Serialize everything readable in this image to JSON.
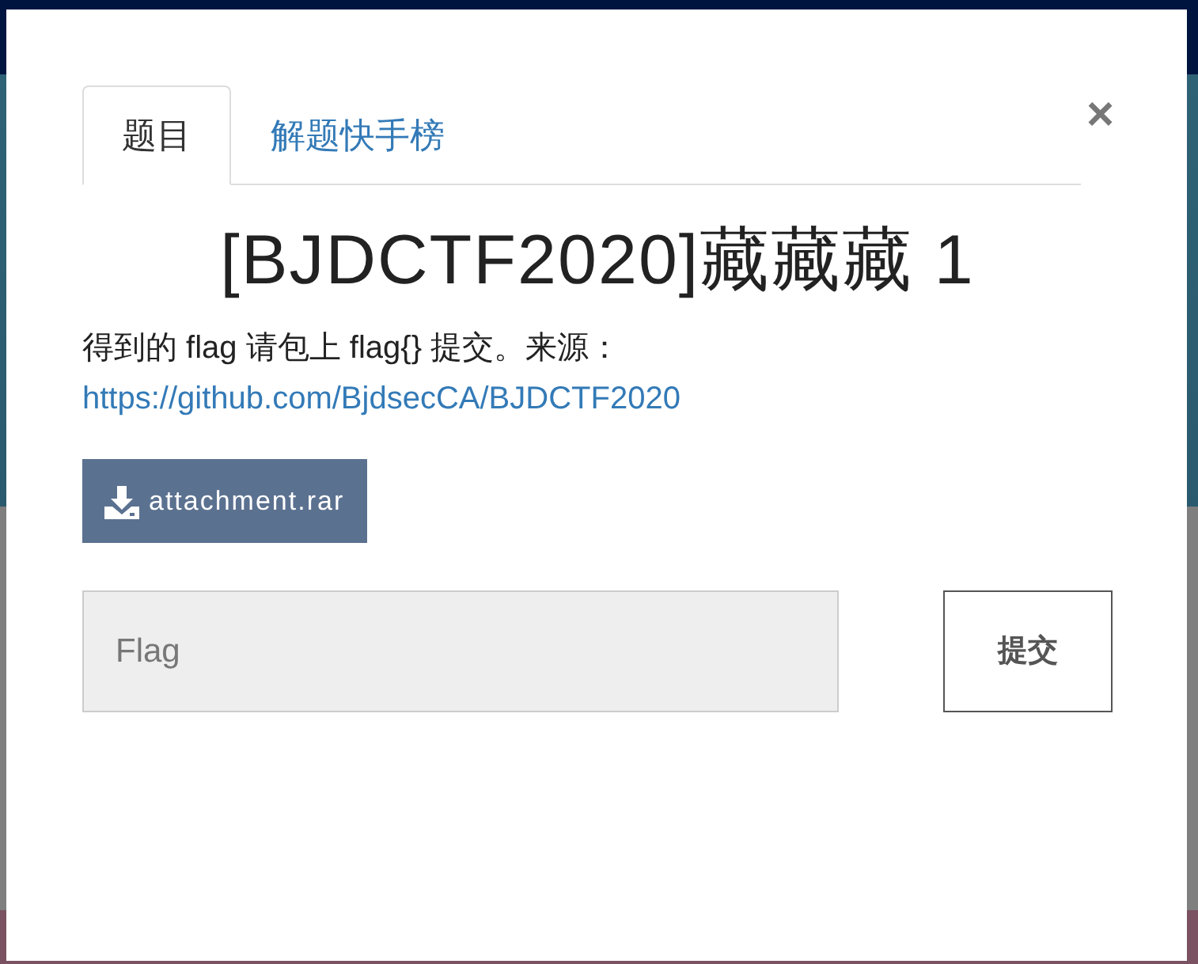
{
  "tabs": [
    {
      "label": "题目",
      "selected": true
    },
    {
      "label": "解题快手榜",
      "selected": false
    }
  ],
  "close": "×",
  "title": "[BJDCTF2020]藏藏藏 1",
  "description": {
    "text": "得到的 flag 请包上 flag{} 提交。来源：",
    "link": "https://github.com/BjdsecCA/BJDCTF2020"
  },
  "attachment": "attachment.rar",
  "flag_field": {
    "placeholder": "Flag"
  },
  "submit": "提交"
}
